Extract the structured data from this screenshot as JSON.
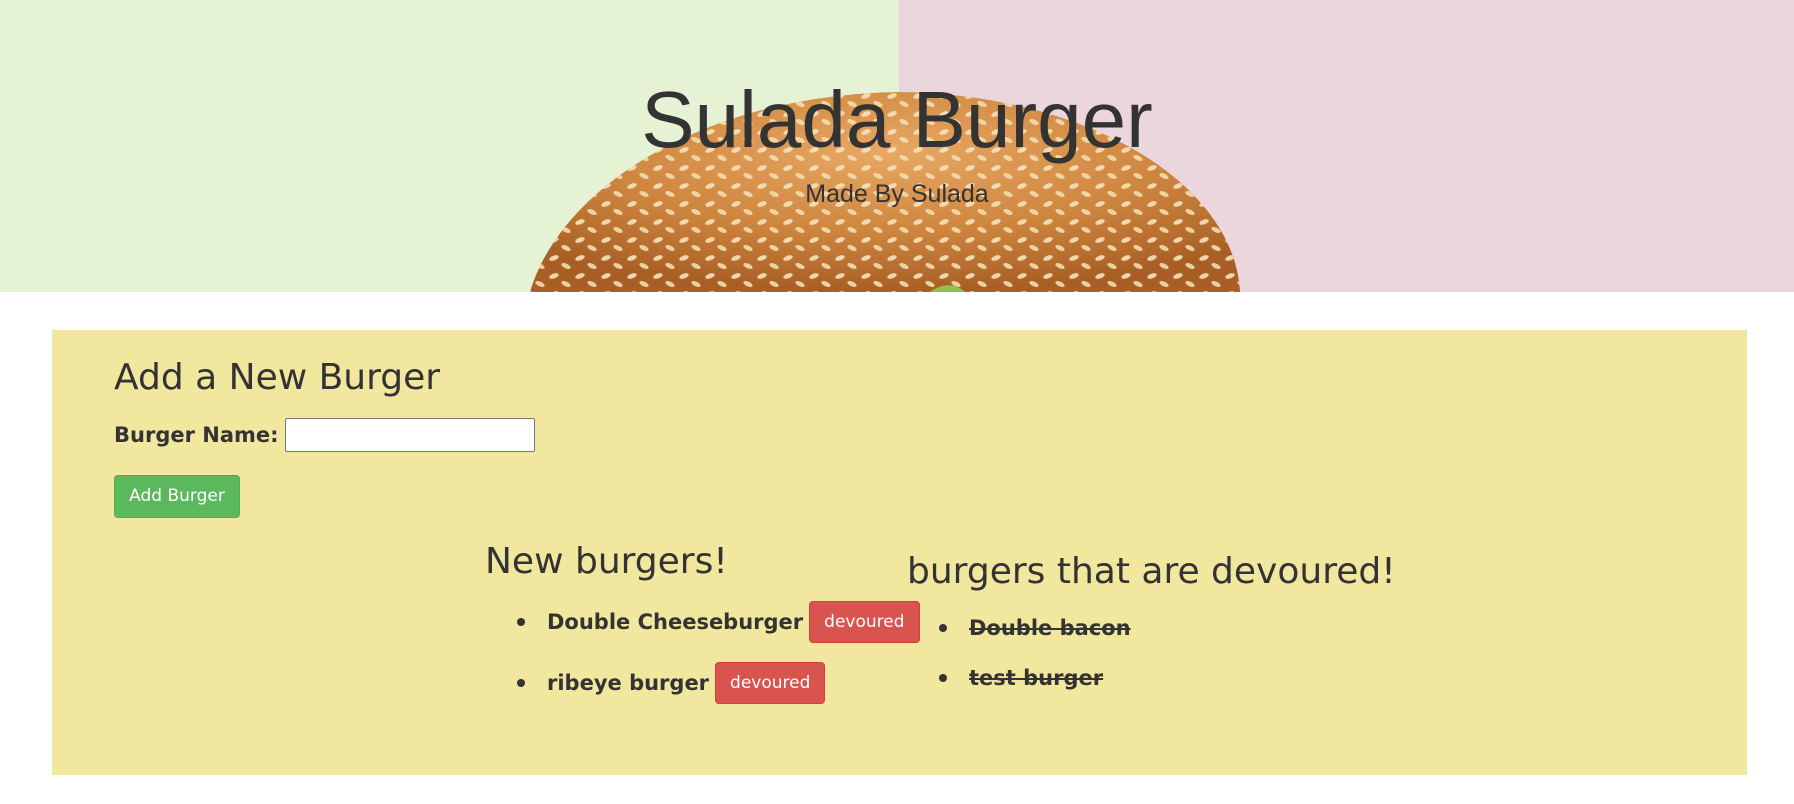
{
  "header": {
    "title": "Sulada Burger",
    "subtitle": "Made By Sulada"
  },
  "form": {
    "heading": "Add a New Burger",
    "label": "Burger Name:",
    "value": "",
    "submit_label": "Add Burger"
  },
  "new_burgers": {
    "heading": "New burgers!",
    "items": [
      {
        "name": "Double Cheeseburger",
        "action": "devoured"
      },
      {
        "name": "ribeye burger",
        "action": "devoured"
      }
    ]
  },
  "devoured_burgers": {
    "heading": "burgers that are devoured!",
    "items": [
      {
        "name": "Double bacon"
      },
      {
        "name": "test burger"
      }
    ]
  },
  "colors": {
    "hero_left": "#e6f2d4",
    "hero_right": "#ecd6dd",
    "panel": "#f1e79f",
    "add_button": "#5cb85c",
    "devour_button": "#d9534f"
  }
}
